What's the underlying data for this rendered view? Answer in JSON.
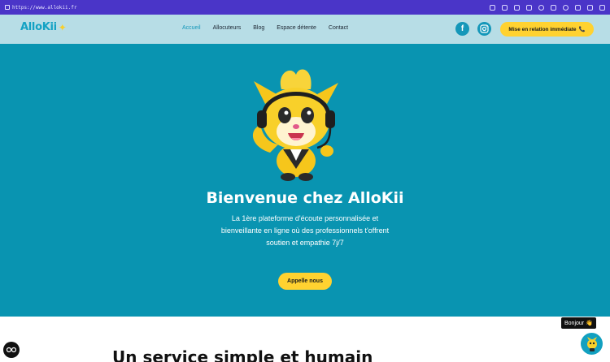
{
  "browser": {
    "url": "https://www.allokii.fr"
  },
  "header": {
    "logo_text": "AlloKii",
    "nav": [
      "Accueil",
      "Allocuteurs",
      "Blog",
      "Espace détente",
      "Contact"
    ],
    "active_nav": "Accueil",
    "cta_label": "Mise en relation immédiate",
    "social": [
      "facebook-icon",
      "instagram-icon"
    ]
  },
  "hero": {
    "title": "Bienvenue chez AlloKii",
    "subtitle": "La 1ère plateforme d'écoute personnalisée et bienveillante en ligne où des professionnels t'offrent soutien et empathie 7j/7",
    "cta_label": "Appelle nous"
  },
  "section": {
    "title": "Un service simple et humain"
  },
  "chat": {
    "tooltip": "Bonjour"
  },
  "colors": {
    "browser_bar": "#4a35c8",
    "header_bg": "#b7dde6",
    "hero_bg": "#0994b1",
    "accent": "#ffd230",
    "brand": "#14a2c4"
  }
}
